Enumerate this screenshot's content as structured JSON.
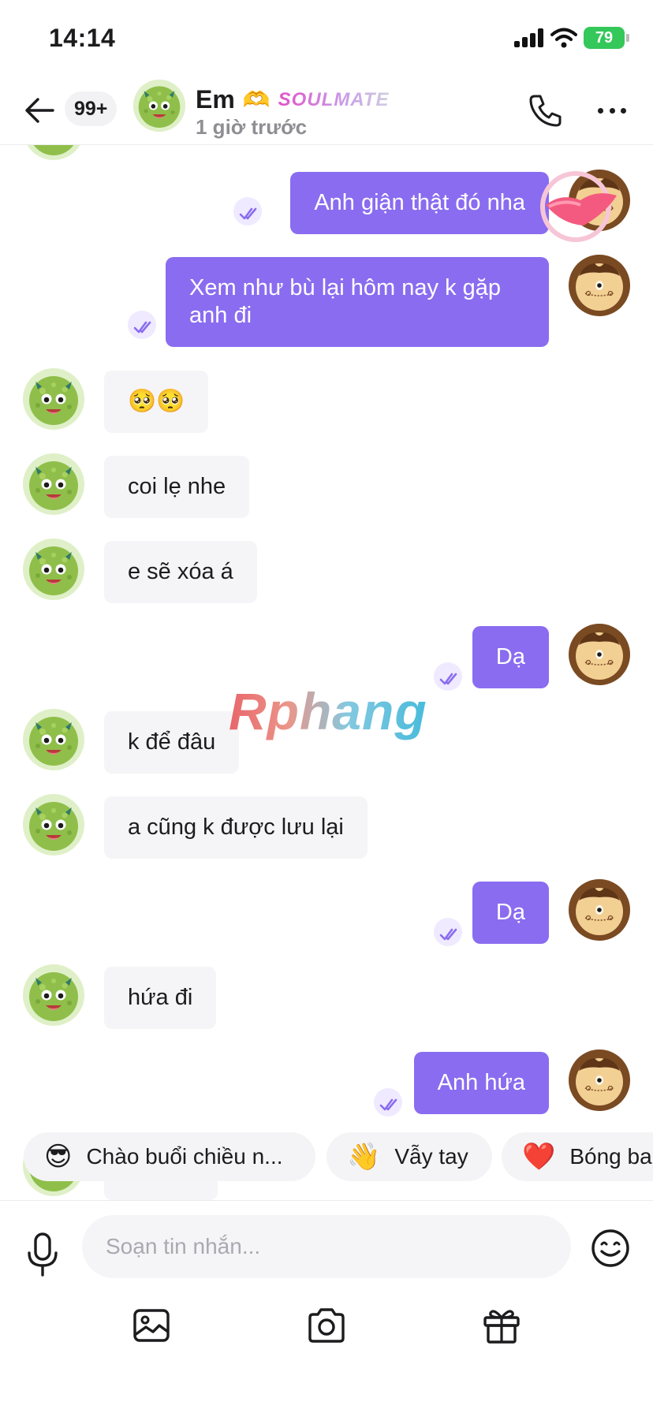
{
  "status_bar": {
    "time": "14:14",
    "battery": "79"
  },
  "header": {
    "unread_count": "99+",
    "contact_name": "Em",
    "name_emoji": "🫶",
    "badge": "SOULMATE",
    "last_seen": "1 giờ trước"
  },
  "messages": [
    {
      "side": "out",
      "text": "Anh giận thật đó nha"
    },
    {
      "side": "out",
      "text": "Xem như bù lại hôm nay k gặp anh đi"
    },
    {
      "side": "in",
      "text": "🥺🥺"
    },
    {
      "side": "in",
      "text": "coi lẹ nhe"
    },
    {
      "side": "in",
      "text": "e sẽ xóa á"
    },
    {
      "side": "out",
      "text": "Dạ"
    },
    {
      "side": "in",
      "text": "k để đâu"
    },
    {
      "side": "in",
      "text": "a cũng k được lưu lại"
    },
    {
      "side": "out",
      "text": "Dạ"
    },
    {
      "side": "in",
      "text": "hứa đi"
    },
    {
      "side": "out",
      "text": "Anh hứa"
    }
  ],
  "watermark": "Rphang",
  "quick_replies": [
    {
      "icon": "😎",
      "label": "Chào buổi chiều n..."
    },
    {
      "icon": "👋",
      "label": "Vẫy tay"
    },
    {
      "icon": "❤️",
      "label": "Bóng ba"
    }
  ],
  "composer": {
    "placeholder": "Soạn tin nhắn..."
  },
  "icons": {
    "back": "arrow-left-icon",
    "call": "phone-icon",
    "more": "more-dots-icon",
    "mic": "microphone-icon",
    "emoji": "smiley-icon",
    "image": "image-icon",
    "camera": "camera-icon",
    "gift": "gift-icon",
    "read": "double-check-icon"
  },
  "colors": {
    "outgoing_bubble": "#8a6cf0",
    "incoming_bubble": "#f5f5f7",
    "read_check": "#8a6cf0",
    "battery": "#34c759"
  }
}
